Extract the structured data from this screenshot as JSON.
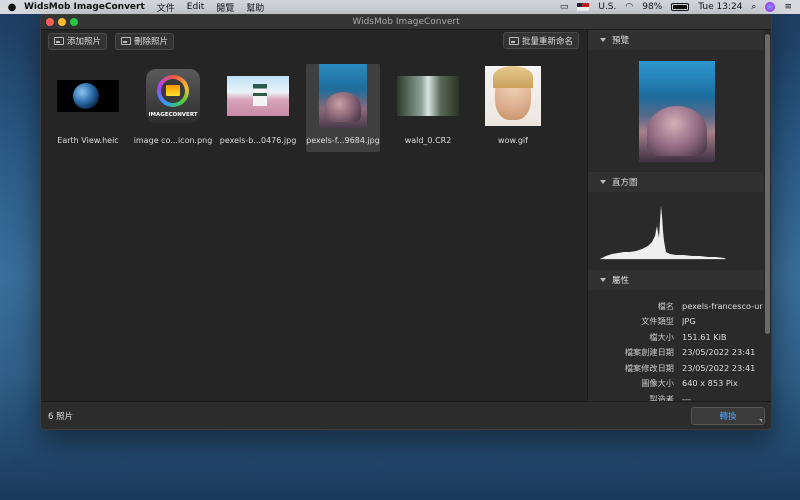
{
  "menubar": {
    "app_name": "WidsMob ImageConvert",
    "menus": [
      "文件",
      "Edit",
      "閱覽",
      "幫助"
    ],
    "input_source": "U.S.",
    "battery": "98%",
    "clock": "Tue 13:24"
  },
  "window": {
    "title": "WidsMob ImageConvert"
  },
  "toolbar": {
    "add_label": "添加照片",
    "delete_label": "刪除照片",
    "rename_label": "批量重新命名"
  },
  "thumbnails": [
    {
      "caption": "Earth View.heic",
      "kind": "earth"
    },
    {
      "caption": "image co...icon.png",
      "kind": "icon",
      "icon_text": "IMAGECONVERT"
    },
    {
      "caption": "pexels-b...0476.jpg",
      "kind": "castle"
    },
    {
      "caption": "pexels-f...9684.jpg",
      "kind": "coral",
      "selected": true
    },
    {
      "caption": "wald_0.CR2",
      "kind": "forest"
    },
    {
      "caption": "wow.gif",
      "kind": "face"
    }
  ],
  "status": {
    "count": "6 照片",
    "convert_label": "轉換"
  },
  "side": {
    "preview_label": "預覽",
    "histogram_label": "直方圖",
    "properties_label": "屬性",
    "properties": [
      {
        "k": "檔名",
        "v": "pexels-francesco-ur"
      },
      {
        "k": "文件類型",
        "v": "JPG"
      },
      {
        "k": "檔大小",
        "v": "151.61 KiB"
      },
      {
        "k": "檔案創建日期",
        "v": "23/05/2022 23:41"
      },
      {
        "k": "檔案修改日期",
        "v": "23/05/2022 23:41"
      },
      {
        "k": "圖像大小",
        "v": "640 x 853 Pix"
      },
      {
        "k": "製造者",
        "v": "---"
      }
    ]
  }
}
